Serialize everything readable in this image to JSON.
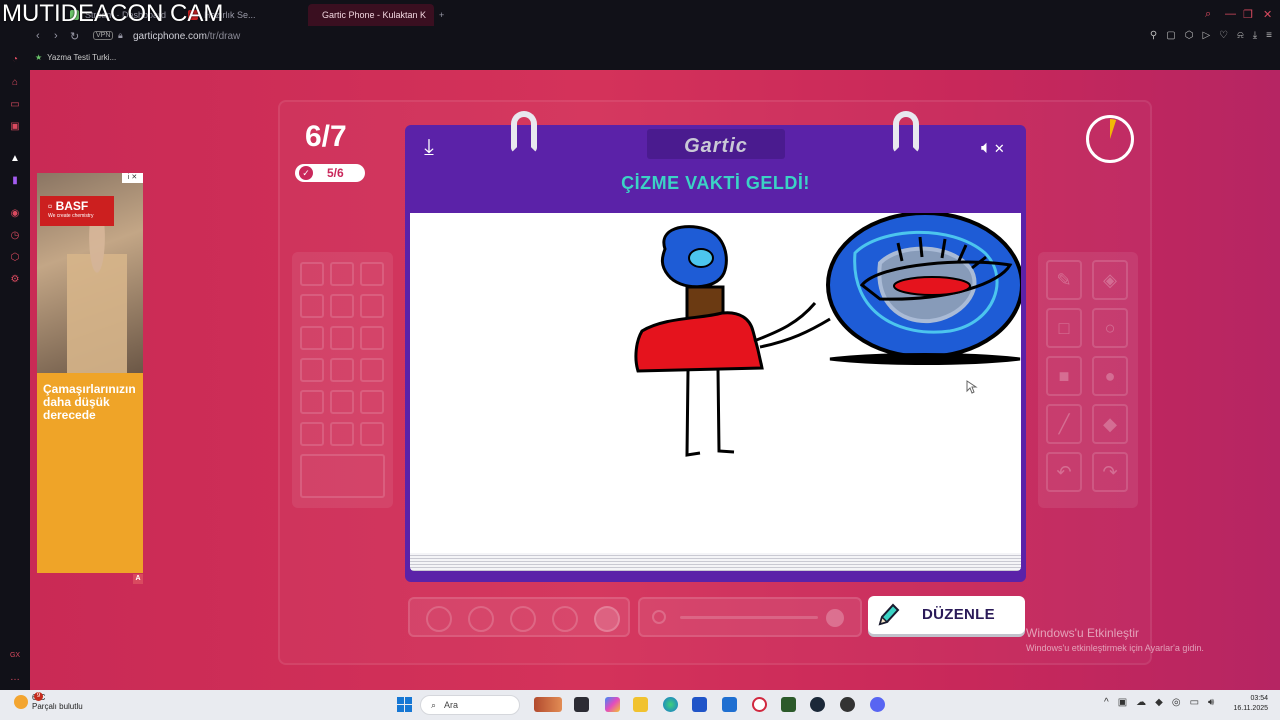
{
  "overlay": {
    "watermark": "MUTIDEACON CAM"
  },
  "browser": {
    "tabs": [
      {
        "label": "Stream · Dashboard",
        "color": "#6ac46a"
      },
      {
        "label": "Hazırlık Se...",
        "prefix": "B",
        "color": "#c92020"
      },
      {
        "label": "Gartic Phone - Kulaktan K",
        "color": "#e23a6b",
        "active": true
      }
    ],
    "new_tab": "+",
    "vpn_label": "VPN",
    "url_host": "garticphone.com",
    "url_path": "/tr/draw",
    "bookmark": "Yazma Testi Turki..."
  },
  "ad": {
    "badge": "i ✕",
    "brand": "▫ BASF",
    "tagline": "We create chemistry",
    "headline": "Çamaşırlarınızın daha düşük derecede",
    "marker": "A"
  },
  "game": {
    "round": "6/7",
    "done_count": "5/6",
    "logo": "Gartic",
    "prompt": "ÇİZME VAKTİ GELDİ!",
    "edit_label": "DÜZENLE",
    "timer_remaining_fraction": 0.05,
    "accent_color": "#3bd3c5",
    "book_color": "#5b22a8"
  },
  "drawing": {
    "figure_head_color": "#1e5cd6",
    "figure_body_color": "#e5131d",
    "ball_fill_color": "#1e5cd6",
    "ball_swirl_color": "#4cc5ee",
    "mouth_color": "#e5131d"
  },
  "windows": {
    "activate_title": "Windows'u Etkinleştir",
    "activate_sub": "Windows'u etkinleştirmek için Ayarlar'a gidin.",
    "weather_temp": "6°C",
    "weather_desc": "Parçalı bulutlu",
    "weather_badge": "9",
    "search_placeholder": "Ara",
    "time": "03:54",
    "date": "16.11.2025"
  }
}
